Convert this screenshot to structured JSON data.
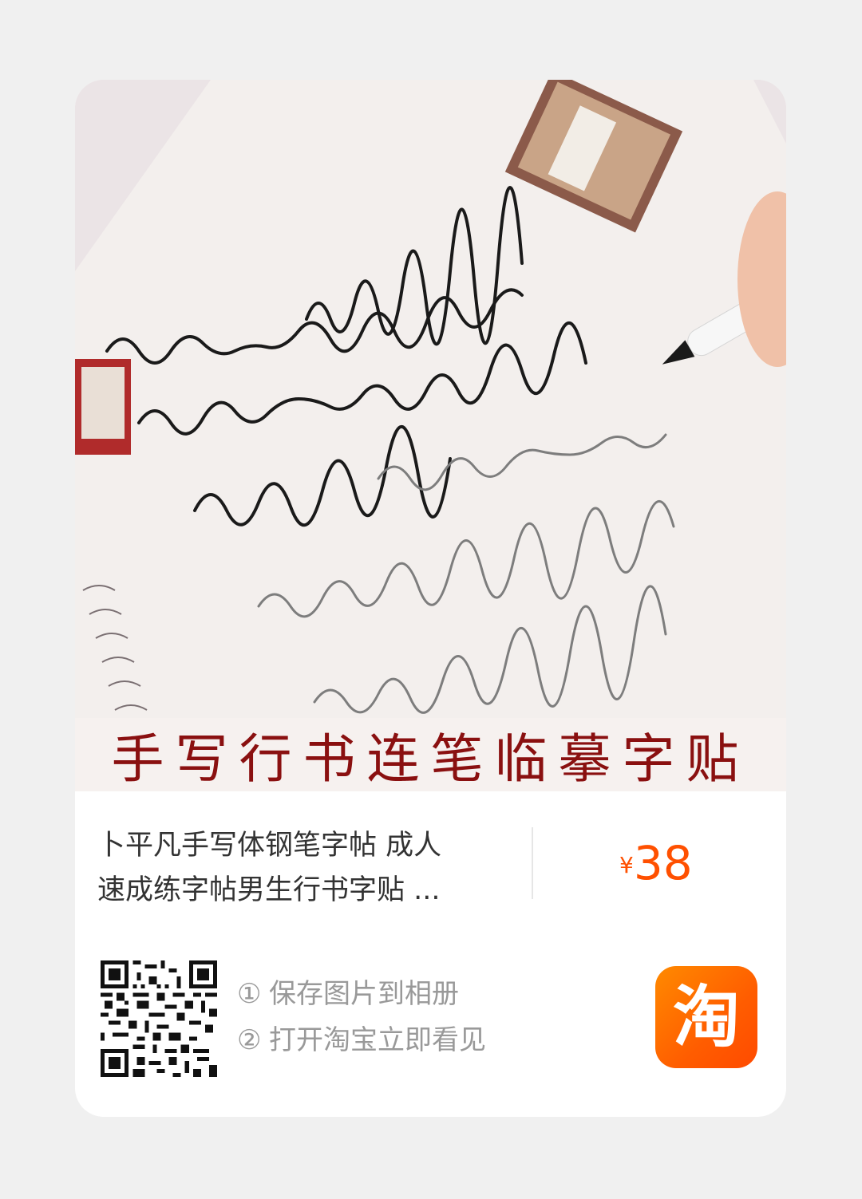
{
  "banner_text": "手写行书连笔临摹字贴",
  "product": {
    "title_line1": "卜平凡手写体钢笔字帖 成人",
    "title_line2": "速成练字帖男生行书字贴 ..."
  },
  "price": {
    "currency": "¥",
    "amount": "38"
  },
  "steps": [
    {
      "num": "①",
      "text": "保存图片到相册"
    },
    {
      "num": "②",
      "text": "打开淘宝立即看见"
    }
  ],
  "app_logo": {
    "char": "淘",
    "color": "#ff5000",
    "icon": "taobao-logo-icon"
  },
  "colors": {
    "accent": "#ff5000",
    "banner_text": "#8a1010",
    "muted": "#999999"
  }
}
